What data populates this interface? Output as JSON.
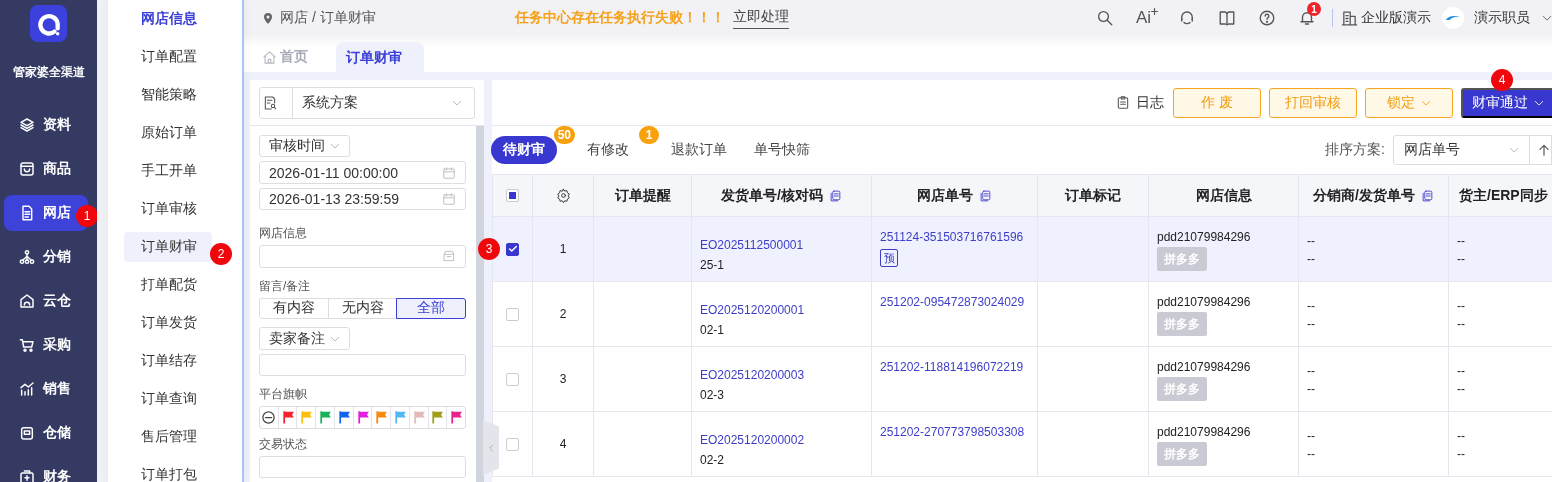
{
  "app": {
    "name": "管家婆全渠道"
  },
  "nav": {
    "items": [
      {
        "label": "资料",
        "selected": false
      },
      {
        "label": "商品",
        "selected": false
      },
      {
        "label": "网店",
        "selected": true,
        "marker": "1"
      },
      {
        "label": "分销",
        "selected": false
      },
      {
        "label": "云仓",
        "selected": false
      },
      {
        "label": "采购",
        "selected": false
      },
      {
        "label": "销售",
        "selected": false
      },
      {
        "label": "仓储",
        "selected": false
      },
      {
        "label": "财务",
        "selected": false
      }
    ]
  },
  "submenu": {
    "items": [
      {
        "label": "网店信息",
        "kind": "heading",
        "selected": false
      },
      {
        "label": "订单配置",
        "kind": "link",
        "selected": false
      },
      {
        "label": "智能策略",
        "kind": "link",
        "selected": false
      },
      {
        "label": "原始订单",
        "kind": "link",
        "selected": false
      },
      {
        "label": "手工开单",
        "kind": "link",
        "selected": false
      },
      {
        "label": "订单审核",
        "kind": "link",
        "selected": false
      },
      {
        "label": "订单财审",
        "kind": "link",
        "selected": true,
        "marker": "2"
      },
      {
        "label": "打单配货",
        "kind": "link",
        "selected": false
      },
      {
        "label": "订单发货",
        "kind": "link",
        "selected": false
      },
      {
        "label": "订单结存",
        "kind": "link",
        "selected": false
      },
      {
        "label": "订单查询",
        "kind": "link",
        "selected": false
      },
      {
        "label": "售后管理",
        "kind": "link",
        "selected": false
      },
      {
        "label": "订单打包",
        "kind": "link",
        "selected": false
      }
    ]
  },
  "breadcrumb": "网店 / 订单财审",
  "alert": {
    "message": "任务中心存在任务执行失败！！！",
    "action": "立即处理"
  },
  "header": {
    "ai_label": "Ai",
    "notifications": "1",
    "org": "企业版演示",
    "user": "演示职员"
  },
  "page_tabs": [
    {
      "label": "首页",
      "selected": false
    },
    {
      "label": "订单财审",
      "selected": true
    }
  ],
  "filters": {
    "scheme": "系统方案",
    "time_field": "审核时间",
    "date_from": "2026-01-11 00:00:00",
    "date_to": "2026-01-13 23:59:59",
    "shop_label": "网店信息",
    "remark_label": "留言/备注",
    "remark_options": [
      {
        "label": "有内容",
        "selected": false
      },
      {
        "label": "无内容",
        "selected": false
      },
      {
        "label": "全部",
        "selected": true
      }
    ],
    "note_field": "卖家备注",
    "flag_label": "平台旗帜",
    "flags": [
      {
        "kind": "none"
      },
      {
        "kind": "flag",
        "color": "#f5222d"
      },
      {
        "kind": "flag",
        "color": "#fcbf0a"
      },
      {
        "kind": "flag",
        "color": "#17b35a"
      },
      {
        "kind": "flag",
        "color": "#1264f0"
      },
      {
        "kind": "flag",
        "color": "#e01fe0"
      },
      {
        "kind": "flag",
        "color": "#f58a0c"
      },
      {
        "kind": "flag",
        "color": "#52b9f2"
      },
      {
        "kind": "flag",
        "color": "#e6b9b9"
      },
      {
        "kind": "flag",
        "color": "#a0a018"
      },
      {
        "kind": "flag",
        "color": "#e8228c"
      }
    ],
    "status_label": "交易状态"
  },
  "toolbar": {
    "log": "日志",
    "buttons": [
      {
        "label": "作 废",
        "kind": "warning",
        "dropdown": false
      },
      {
        "label": "打回审核",
        "kind": "warning",
        "dropdown": false
      },
      {
        "label": "锁定",
        "kind": "warning",
        "dropdown": true
      },
      {
        "label": "财审通过",
        "kind": "primary",
        "dropdown": true,
        "marker": "4"
      }
    ]
  },
  "status_tabs": [
    {
      "label": "待财审",
      "selected": true,
      "count": "50"
    },
    {
      "label": "有修改",
      "selected": false,
      "count": "1"
    },
    {
      "label": "退款订单",
      "selected": false
    },
    {
      "label": "单号快筛",
      "selected": false
    }
  ],
  "sort": {
    "label": "排序方案:",
    "value": "网店单号"
  },
  "table": {
    "partially_selected": true,
    "columns": [
      {
        "kind": "select"
      },
      {
        "kind": "settings"
      },
      {
        "kind": "text",
        "label": "订单提醒",
        "copy": false
      },
      {
        "kind": "text",
        "label": "发货单号/核对码",
        "copy": true
      },
      {
        "kind": "text",
        "label": "网店单号",
        "copy": true
      },
      {
        "kind": "text",
        "label": "订单标记",
        "copy": false
      },
      {
        "kind": "text",
        "label": "网店信息",
        "copy": false
      },
      {
        "kind": "text",
        "label": "分销商/发货单号",
        "copy": true
      },
      {
        "kind": "text",
        "label": "货主/ERP同步",
        "copy": false
      }
    ],
    "rows": [
      {
        "selected": true,
        "marker": "3",
        "number": "1",
        "shipping_no": "EO2025112500001",
        "check_code": "25-1",
        "shop_order_no": "251124-351503716761596",
        "tags": [
          "预"
        ],
        "shop": "pdd21079984296",
        "platform": "拼多多",
        "distributor": [
          "--",
          "--"
        ],
        "owner": [
          "--",
          "--"
        ]
      },
      {
        "selected": false,
        "number": "2",
        "shipping_no": "EO2025120200001",
        "check_code": "02-1",
        "shop_order_no": "251202-095472873024029",
        "shop": "pdd21079984296",
        "platform": "拼多多",
        "distributor": [
          "--",
          "--"
        ],
        "owner": [
          "--",
          "--"
        ]
      },
      {
        "selected": false,
        "number": "3",
        "shipping_no": "EO2025120200003",
        "check_code": "02-3",
        "shop_order_no": "251202-118814196072219",
        "shop": "pdd21079984296",
        "platform": "拼多多",
        "distributor": [
          "--",
          "--"
        ],
        "owner": [
          "--",
          "--"
        ]
      },
      {
        "selected": false,
        "number": "4",
        "shipping_no": "EO2025120200002",
        "check_code": "02-2",
        "shop_order_no": "251202-270773798503308",
        "shop": "pdd21079984296",
        "platform": "拼多多",
        "distributor": [
          "--",
          "--"
        ],
        "owner": [
          "--",
          "--"
        ]
      }
    ]
  }
}
